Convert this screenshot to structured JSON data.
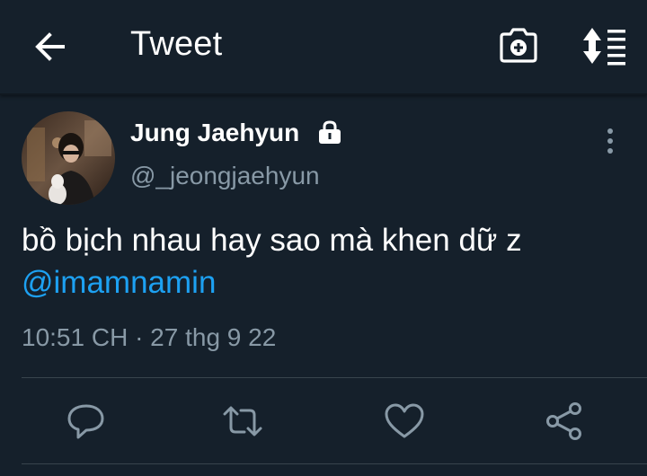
{
  "header": {
    "title": "Tweet",
    "back_icon": "arrow-left-icon",
    "camera_icon": "camera-plus-icon",
    "sort_icon": "sort-list-icon"
  },
  "tweet": {
    "author_name": "Jung Jaehyun",
    "handle": "@_jeongjaehyun",
    "protected_icon": "lock-icon",
    "text": "bồ bịch nhau hay sao mà khen dữ z",
    "mention": "@imamnamin",
    "timestamp": "10:51 CH · 27 thg 9 22"
  },
  "actions": [
    {
      "name": "reply",
      "icon": "reply-icon"
    },
    {
      "name": "retweet",
      "icon": "retweet-icon"
    },
    {
      "name": "like",
      "icon": "heart-icon"
    },
    {
      "name": "share",
      "icon": "share-icon"
    }
  ],
  "colors": {
    "background": "#15202b",
    "text": "#ffffff",
    "secondary": "#8899a6",
    "accent": "#1da1f2",
    "divider": "#38444d"
  }
}
